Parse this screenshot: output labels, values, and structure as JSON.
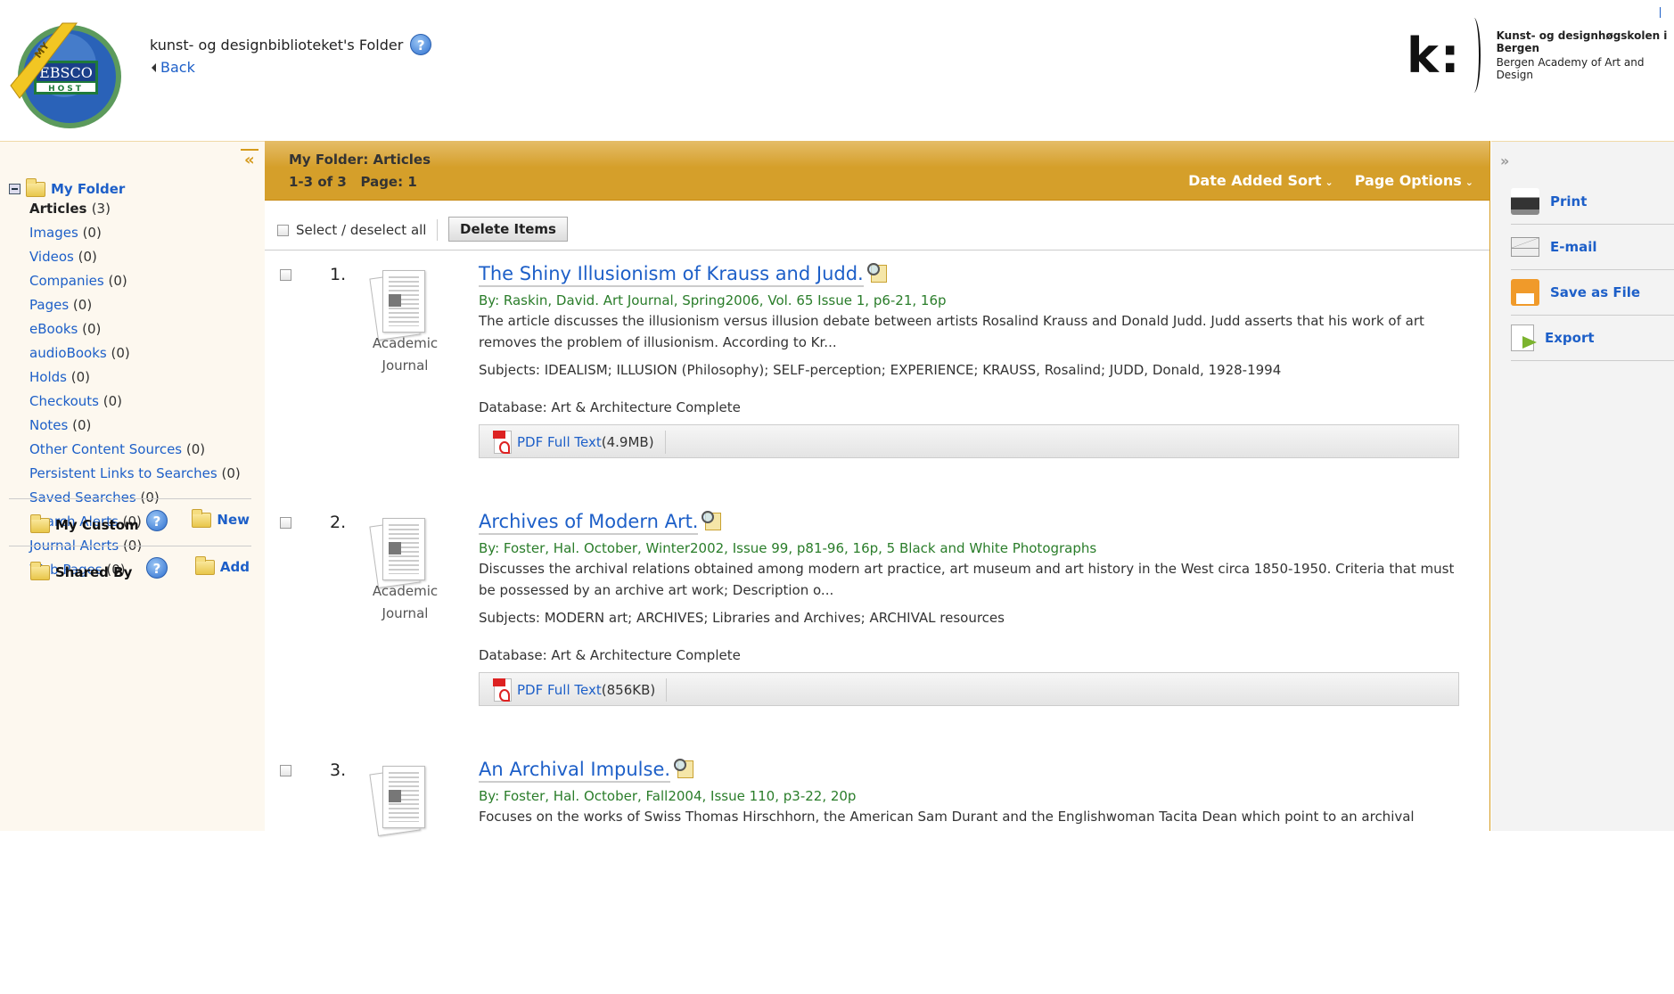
{
  "header": {
    "logo_text": "MY EBSCO HOST",
    "folder_title": "kunst- og designbiblioteket's Folder",
    "back_label": "Back",
    "institution_logo_mark": "k:",
    "institution_name_no": "Kunst- og designhøgskolen i Bergen",
    "institution_name_en": "Bergen Academy of Art and Design"
  },
  "sidebar": {
    "collapse_icon": "«",
    "root_label": "My Folder",
    "items": [
      {
        "label": "Articles",
        "count": "(3)",
        "active": true
      },
      {
        "label": "Images",
        "count": "(0)"
      },
      {
        "label": "Videos",
        "count": "(0)"
      },
      {
        "label": "Companies",
        "count": "(0)"
      },
      {
        "label": "Pages",
        "count": "(0)"
      },
      {
        "label": "eBooks",
        "count": "(0)"
      },
      {
        "label": "audioBooks",
        "count": "(0)"
      },
      {
        "label": "Holds",
        "count": "(0)"
      },
      {
        "label": "Checkouts",
        "count": "(0)"
      },
      {
        "label": "Notes",
        "count": "(0)"
      },
      {
        "label": "Other Content Sources",
        "count": "(0)"
      },
      {
        "label": "Persistent Links to Searches",
        "count": "(0)"
      },
      {
        "label": "Saved Searches",
        "count": "(0)"
      },
      {
        "label": "Search Alerts",
        "count": "(0)"
      },
      {
        "label": "Journal Alerts",
        "count": "(0)"
      },
      {
        "label": "Web Pages",
        "count": "(0)"
      }
    ],
    "my_custom": {
      "label": "My Custom",
      "action": "New"
    },
    "shared_by": {
      "label": "Shared By",
      "action": "Add"
    }
  },
  "main": {
    "title": "My Folder: Articles",
    "count": "1-3 of 3   Page: 1",
    "sort_label": "Date Added Sort",
    "page_options_label": "Page Options",
    "select_all_label": "Select / deselect all",
    "delete_label": "Delete Items",
    "records": [
      {
        "number": "1.",
        "type_line1": "Academic",
        "type_line2": "Journal",
        "title": "The Shiny Illusionism of Krauss and Judd.",
        "byline": "By: Raskin, David. Art Journal, Spring2006, Vol. 65 Issue 1, p6-21, 16p",
        "abstract": "The article discusses the illusionism versus illusion debate between artists Rosalind Krauss and Donald Judd. Judd asserts that his work of art removes the problem of illusionism. According to Kr...",
        "subjects": "Subjects: IDEALISM; ILLUSION (Philosophy); SELF-perception; EXPERIENCE; KRAUSS, Rosalind; JUDD, Donald, 1928-1994",
        "database": "Database: Art & Architecture Complete",
        "pdf_label": "PDF Full Text",
        "pdf_size": "(4.9MB)"
      },
      {
        "number": "2.",
        "type_line1": "Academic",
        "type_line2": "Journal",
        "title": "Archives of Modern Art.",
        "byline": "By: Foster, Hal. October, Winter2002, Issue 99, p81-96, 16p, 5 Black and White Photographs",
        "abstract": "Discusses the archival relations obtained among modern art practice, art museum and art history in the West circa 1850-1950. Criteria that must be possessed by an archive art work; Description o...",
        "subjects": "Subjects: MODERN art; ARCHIVES; Libraries and Archives; ARCHIVAL resources",
        "database": "Database: Art & Architecture Complete",
        "pdf_label": "PDF Full Text",
        "pdf_size": "(856KB)"
      },
      {
        "number": "3.",
        "title": "An Archival Impulse.",
        "byline": "By: Foster, Hal. October, Fall2004, Issue 110, p3-22, 20p",
        "abstract": "Focuses on the works of Swiss Thomas Hirschhorn, the American Sam Durant and the Englishwoman Tacita Dean which point to an archival"
      }
    ]
  },
  "tools": {
    "expand_icon": "»",
    "items": [
      {
        "label": "Print",
        "icon": "printer-icon"
      },
      {
        "label": "E-mail",
        "icon": "email-icon"
      },
      {
        "label": "Save as File",
        "icon": "floppy-disk-icon"
      },
      {
        "label": "Export",
        "icon": "export-icon"
      }
    ]
  }
}
